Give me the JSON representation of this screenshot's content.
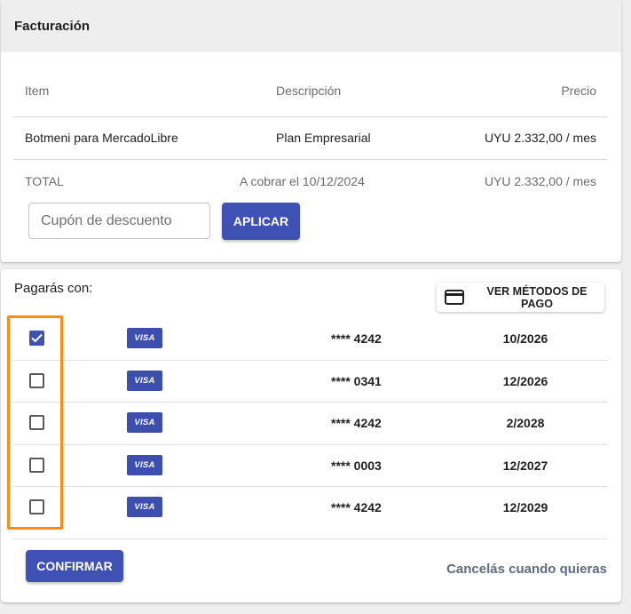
{
  "billing": {
    "title": "Facturación",
    "columns": {
      "item": "Item",
      "description": "Descripción",
      "price": "Precio"
    },
    "line_item": {
      "item": "Botmeni para MercadoLibre",
      "description": "Plan Empresarial",
      "price": "UYU 2.332,00 / mes"
    },
    "total": {
      "label": "TOTAL",
      "charge_date": "A cobrar el 10/12/2024",
      "price": "UYU 2.332,00 / mes"
    },
    "coupon": {
      "placeholder": "Cupón de descuento",
      "value": ""
    },
    "apply_label": "APLICAR"
  },
  "payment": {
    "label": "Pagarás con:",
    "view_methods_label": "VER MÉTODOS DE PAGO",
    "cards": [
      {
        "brand": "VISA",
        "number": "**** 4242",
        "expiry": "10/2026",
        "selected": true
      },
      {
        "brand": "VISA",
        "number": "**** 0341",
        "expiry": "12/2026",
        "selected": false
      },
      {
        "brand": "VISA",
        "number": "**** 4242",
        "expiry": "2/2028",
        "selected": false
      },
      {
        "brand": "VISA",
        "number": "**** 0003",
        "expiry": "12/2027",
        "selected": false
      },
      {
        "brand": "VISA",
        "number": "**** 4242",
        "expiry": "12/2029",
        "selected": false
      }
    ],
    "confirm_label": "CONFIRMAR",
    "cancel_text": "Cancelás cuando quieras"
  },
  "colors": {
    "primary": "#3f51b5",
    "visa_badge": "#3d4fae",
    "highlight": "#ff8c1a",
    "header_bg": "#eeeeee"
  },
  "icons": {
    "credit_card": "credit-card-icon",
    "checkbox_checked": "check-icon"
  }
}
